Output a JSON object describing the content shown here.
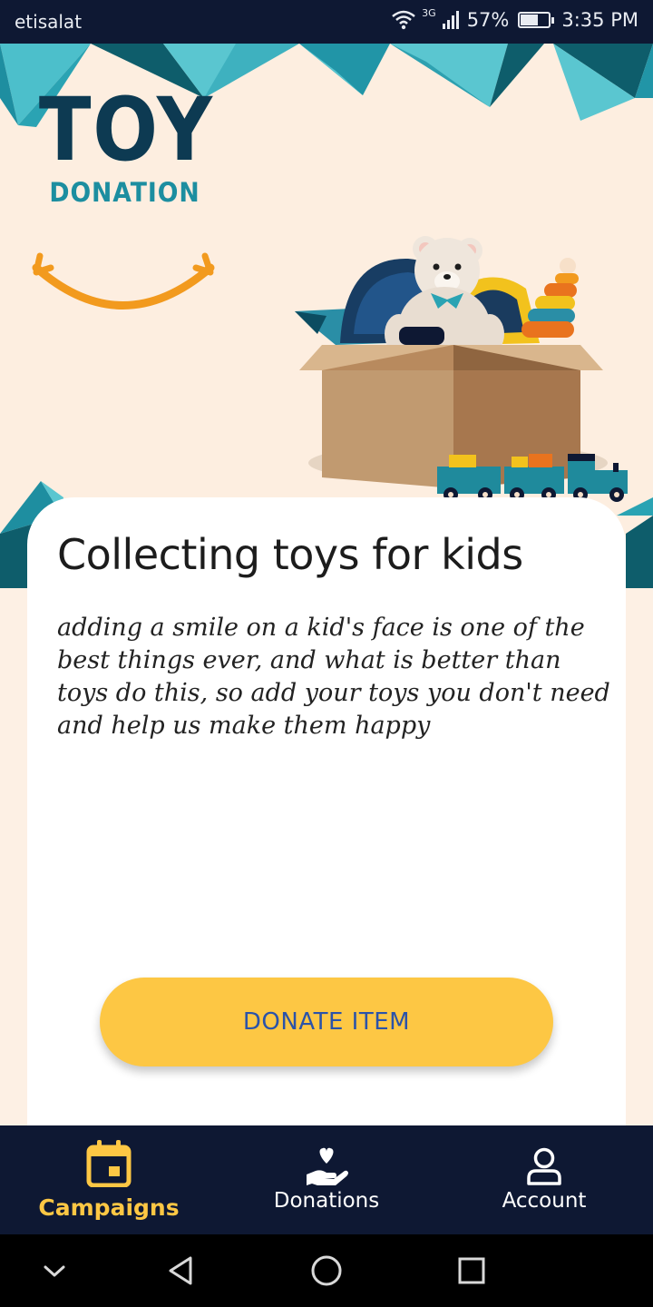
{
  "status_bar": {
    "carrier": "etisalat",
    "network": "3G",
    "battery": "57%",
    "battery_level": 0.57,
    "time": "3:35 PM",
    "icons": [
      "wifi-icon",
      "signal-icon",
      "battery-icon"
    ]
  },
  "logo": {
    "title": "TOY",
    "subtitle": "DONATION"
  },
  "card": {
    "title": "Collecting toys for kids",
    "description": "adding a smile on a kid's face is one of the best things ever, and what is better than toys do this, so add your toys you don't need and help us make them happy"
  },
  "donate_button": {
    "label": "DONATE ITEM"
  },
  "bottom_nav": {
    "items": [
      {
        "label": "Campaigns",
        "icon": "calendar-icon",
        "active": true
      },
      {
        "label": "Donations",
        "icon": "heart-hand-icon",
        "active": false
      },
      {
        "label": "Account",
        "icon": "person-icon",
        "active": false
      }
    ]
  },
  "system_nav": {
    "icons": [
      "chevron-down-icon",
      "back-icon",
      "home-icon",
      "recents-icon"
    ]
  },
  "colors": {
    "navy": "#0e1833",
    "accent_yellow": "#fdc744",
    "button_text": "#2b53a9",
    "logo_navy": "#0d3a52",
    "logo_teal": "#1c8ea0",
    "smile_orange": "#f29a1e",
    "background": "#fdeee0"
  }
}
